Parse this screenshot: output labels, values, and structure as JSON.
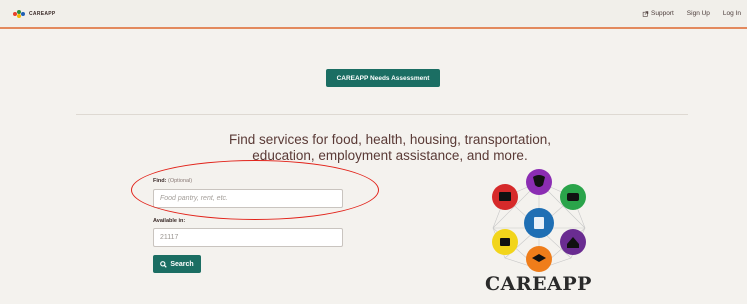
{
  "header": {
    "brand": "CAREAPP",
    "nav": {
      "support": "Support",
      "signup": "Sign Up",
      "login": "Log In"
    }
  },
  "assessment_button": "CAREAPP Needs Assessment",
  "headline": "Find services for food, health, housing, transportation, education, employment assistance, and more.",
  "search": {
    "find_label": "Find:",
    "find_optional": "(Optional)",
    "find_placeholder": "Food pantry, rent, etc.",
    "available_label": "Available in:",
    "available_value": "21117",
    "search_button": "Search"
  },
  "logo": {
    "wordmark": "CAREAPP"
  },
  "colors": {
    "accent": "#1b6e63",
    "header_border": "#e3895d",
    "annotation": "#e2231a"
  }
}
